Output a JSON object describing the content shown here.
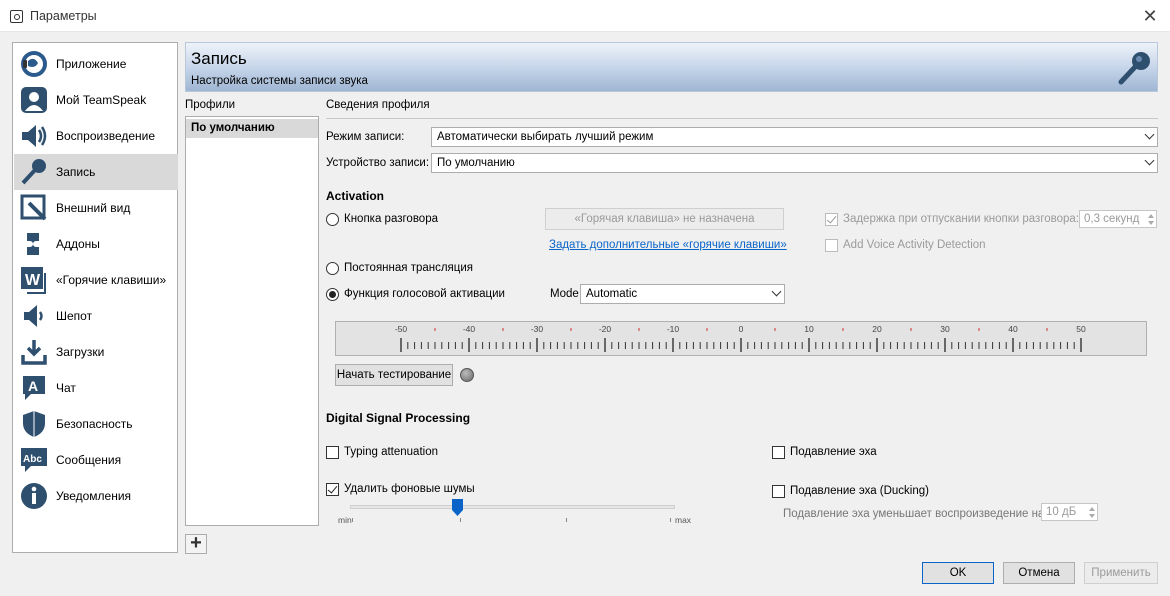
{
  "window": {
    "title": "Параметры",
    "close_glyph": "✕"
  },
  "sidebar": {
    "items": [
      {
        "label": "Приложение",
        "icon": "teamspeak-logo-icon"
      },
      {
        "label": "Мой TeamSpeak",
        "icon": "user-avatar-icon"
      },
      {
        "label": "Воспроизведение",
        "icon": "speaker-icon"
      },
      {
        "label": "Запись",
        "icon": "microphone-icon"
      },
      {
        "label": "Внешний вид",
        "icon": "pen-icon"
      },
      {
        "label": "Аддоны",
        "icon": "puzzle-icon"
      },
      {
        "label": "«Горячие клавиши»",
        "icon": "hotkey-w-icon"
      },
      {
        "label": "Шепот",
        "icon": "speaker-small-icon"
      },
      {
        "label": "Загрузки",
        "icon": "download-icon"
      },
      {
        "label": "Чат",
        "icon": "chat-a-icon"
      },
      {
        "label": "Безопасность",
        "icon": "shield-icon"
      },
      {
        "label": "Сообщения",
        "icon": "abc-message-icon"
      },
      {
        "label": "Уведомления",
        "icon": "info-icon"
      }
    ],
    "selected_index": 3
  },
  "header": {
    "title": "Запись",
    "subtitle": "Настройка системы записи звука"
  },
  "profiles": {
    "label": "Профили",
    "items": [
      "По умолчанию"
    ],
    "add_glyph": "+"
  },
  "profile_info": {
    "section_label": "Сведения профиля",
    "record_mode_label": "Режим записи:",
    "record_mode_value": "Автоматически выбирать лучший режим",
    "device_label": "Устройство записи:",
    "device_value": "По умолчанию"
  },
  "activation": {
    "heading": "Activation",
    "ptt_label": "Кнопка разговора",
    "hotkey_button": "«Горячая клавиша» не назначена",
    "hotkey_link": "Задать дополнительные «горячие клавиши»",
    "delay_label": "Задержка при отпускании кнопки разговора:",
    "delay_value": "0,3 секунд",
    "vad_label": "Add Voice Activity Detection",
    "continuous_label": "Постоянная трансляция",
    "voice_label": "Функция голосовой активации",
    "mode_label": "Mode",
    "mode_value": "Automatic",
    "selected": "voice"
  },
  "meter": {
    "ticks": [
      "-50",
      "-40",
      "-30",
      "-20",
      "-10",
      "0",
      "10",
      "20",
      "30",
      "40",
      "50"
    ]
  },
  "test_button": "Начать тестирование",
  "dsp": {
    "heading": "Digital Signal Processing",
    "typing_label": "Typing attenuation",
    "typing_checked": false,
    "noise_label": "Удалить фоновые шумы",
    "noise_checked": true,
    "slider_min": "min",
    "slider_max": "max",
    "slider_level": 0.33,
    "echo_label": "Подавление эха",
    "echo_checked": false,
    "ducking_label": "Подавление эха (Ducking)",
    "ducking_checked": false,
    "ducking_reduce_label": "Подавление эха уменьшает воспроизведение на:",
    "ducking_value": "10 дБ"
  },
  "buttons": {
    "ok": "OK",
    "cancel": "Отмена",
    "apply": "Применить"
  }
}
